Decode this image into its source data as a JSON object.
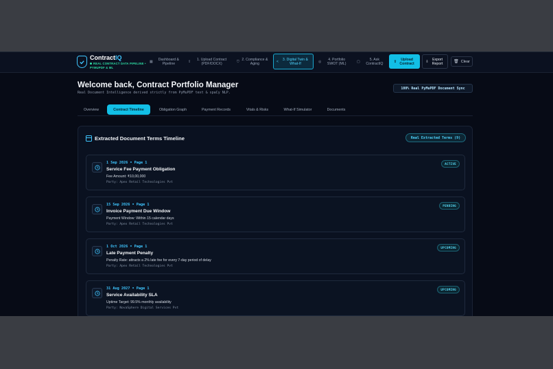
{
  "header": {
    "brand_prefix": "Contract",
    "brand_suffix": "IQ",
    "tagline": "Real Contract Data Pipeline • PyMuPDF & ML",
    "nav": [
      {
        "icon": "grid-icon",
        "label": "Dashboard & Pipeline"
      },
      {
        "icon": "upload-icon",
        "label": "1. Upload Contract (PDF/DOCX)"
      },
      {
        "icon": "shield-check-icon",
        "label": "2. Compliance & Aging"
      },
      {
        "icon": "share-icon",
        "label": "3. Digital Twin & What-If"
      },
      {
        "icon": "target-icon",
        "label": "4. Portfolio SWOT (ML)"
      },
      {
        "icon": "chat-icon",
        "label": "5. Ask ContractIQ"
      }
    ],
    "upload_button": "Upload Contract",
    "export_button": "Export Report",
    "clear_button": "Clear"
  },
  "page": {
    "title": "Welcome back, Contract Portfolio Manager",
    "subtitle": "Real Document Intelligence derived strictly from PyMuPDF text & spaCy NLP.",
    "sync_badge": "100% Real PyMuPDF Document Sync"
  },
  "tabs": [
    "Overview",
    "Contract Timeline",
    "Obligation Graph",
    "Payment Records",
    "Vitals & Risks",
    "What-If Simulator",
    "Documents"
  ],
  "active_tab": "Contract Timeline",
  "timeline": {
    "title": "Extracted Document Terms Timeline",
    "badge": "Real Extracted Terms (9)",
    "items": [
      {
        "date": "1 Sep 2026 • Page 1",
        "title": "Service Fee Payment Obligation",
        "detail": "Fee Amount: ₹10,00,000",
        "party": "Party: Apex Retail Technologies Pvt",
        "status": "ACTIVE"
      },
      {
        "date": "15 Sep 2026 • Page 1",
        "title": "Invoice Payment Due Window",
        "detail": "Payment Window: Within 15 calendar days",
        "party": "Party: Apex Retail Technologies Pvt",
        "status": "PENDING"
      },
      {
        "date": "1 Oct 2026 • Page 1",
        "title": "Late Payment Penalty",
        "detail": "Penalty Rate: attracts a 2% late fee for every 7-day period of delay",
        "party": "Party: Apex Retail Technologies Pvt",
        "status": "UPCOMING"
      },
      {
        "date": "31 Aug 2027 • Page 1",
        "title": "Service Availability SLA",
        "detail": "Uptime Target: 99.5% monthly availability",
        "party": "Party: NovaSphere Digital Services Pvt",
        "status": "UPCOMING"
      }
    ]
  },
  "colors": {
    "accent": "#12bfe6",
    "background": "#070b16",
    "date_text": "#3fc6ff"
  }
}
